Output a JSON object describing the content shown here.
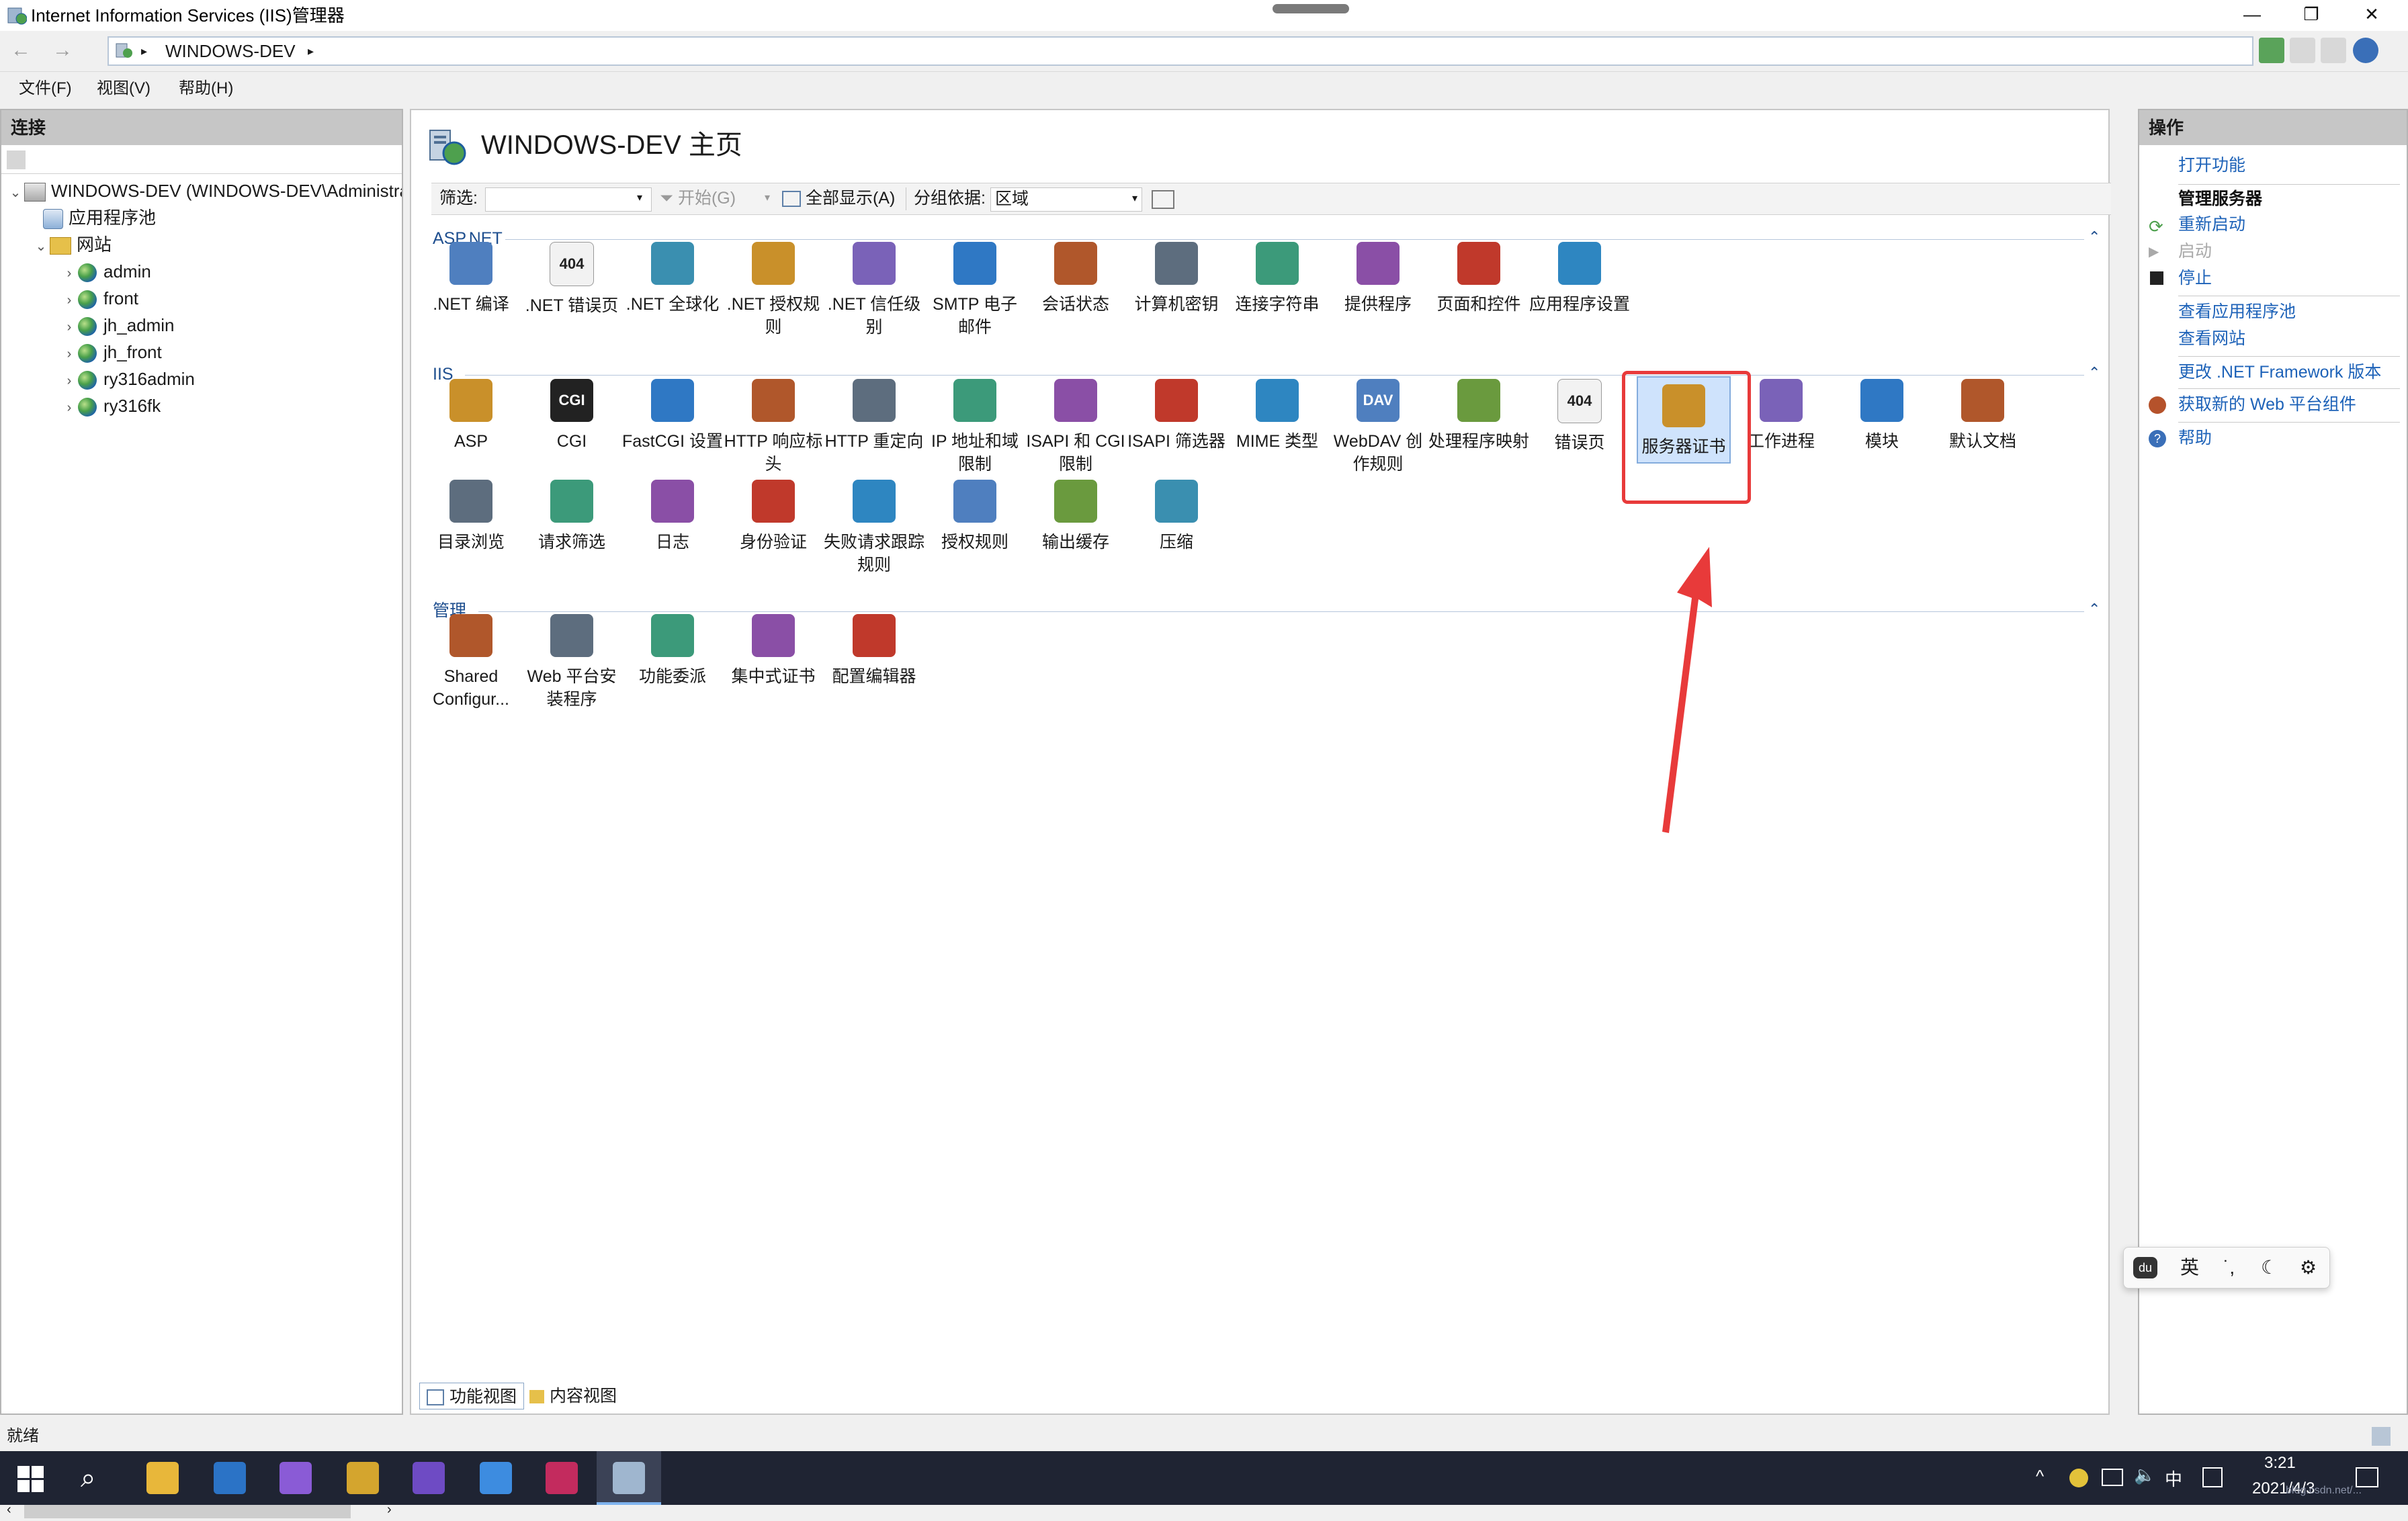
{
  "window": {
    "title": "Internet Information Services (IIS)管理器",
    "minimize": "—",
    "maximize": "❐",
    "close": "✕"
  },
  "address": {
    "back": "←",
    "forward": "→",
    "crumb_sep": "▸",
    "crumb": "WINDOWS-DEV",
    "crumb_sep_end": "▸"
  },
  "menu": [
    "文件(F)",
    "视图(V)",
    "帮助(H)"
  ],
  "connections": {
    "header": "连接",
    "tree": {
      "server": "WINDOWS-DEV (WINDOWS-DEV\\Administrator)",
      "app_pools": "应用程序池",
      "sites": "网站",
      "site_list": [
        "admin",
        "front",
        "jh_admin",
        "jh_front",
        "ry316admin",
        "ry316fk"
      ]
    }
  },
  "center": {
    "title": "WINDOWS-DEV 主页",
    "filter_label": "筛选:",
    "go_label": "开始(G)",
    "show_all_label": "全部显示(A)",
    "group_by_label": "分组依据:",
    "group_by_value": "区域",
    "sections": [
      {
        "name": "ASP.NET",
        "tiles": [
          ".NET 编译",
          ".NET 错误页",
          ".NET 全球化",
          ".NET 授权规则",
          ".NET 信任级别",
          "SMTP 电子邮件",
          "会话状态",
          "计算机密钥",
          "连接字符串",
          "提供程序",
          "页面和控件",
          "应用程序设置"
        ]
      },
      {
        "name": "IIS",
        "tiles": [
          "ASP",
          "CGI",
          "FastCGI 设置",
          "HTTP 响应标头",
          "HTTP 重定向",
          "IP 地址和域限制",
          "ISAPI 和 CGI 限制",
          "ISAPI 筛选器",
          "MIME 类型",
          "WebDAV 创作规则",
          "处理程序映射",
          "错误页",
          "服务器证书",
          "工作进程",
          "模块",
          "默认文档",
          "目录浏览",
          "请求筛选",
          "日志",
          "身份验证",
          "失败请求跟踪规则",
          "授权规则",
          "输出缓存",
          "压缩"
        ]
      },
      {
        "name": "管理",
        "tiles": [
          "Shared Configur...",
          "Web 平台安装程序",
          "功能委派",
          "集中式证书",
          "配置编辑器"
        ]
      }
    ],
    "cgi_icon_text": "CGI",
    "error_icon_text": "404",
    "webdav_icon_text": "DAV",
    "selected_tile": "服务器证书",
    "view_tabs": [
      "功能视图",
      "内容视图"
    ]
  },
  "actions": {
    "header": "操作",
    "open_feature": "打开功能",
    "manage_server_head": "管理服务器",
    "restart": "重新启动",
    "start": "启动",
    "stop": "停止",
    "view_app_pools": "查看应用程序池",
    "view_sites": "查看网站",
    "change_framework": "更改 .NET Framework 版本",
    "get_web_platform": "获取新的 Web 平台组件",
    "help": "帮助"
  },
  "ime": {
    "logo": "du",
    "lang": "英",
    "punct": "˙,",
    "moon": "☾",
    "gear": "⚙"
  },
  "status": {
    "text": "就绪"
  },
  "taskbar": {
    "time": "3:21",
    "date": "2021/4/3",
    "ime_mode": "中",
    "watermark": "blog.csdn.net/..."
  },
  "colors": {
    "link": "#1d62b8",
    "selection": "#cfe3fc",
    "highlight_box": "#e83a3a",
    "arrow": "#e83a3a",
    "taskbar": "#1f2433"
  }
}
